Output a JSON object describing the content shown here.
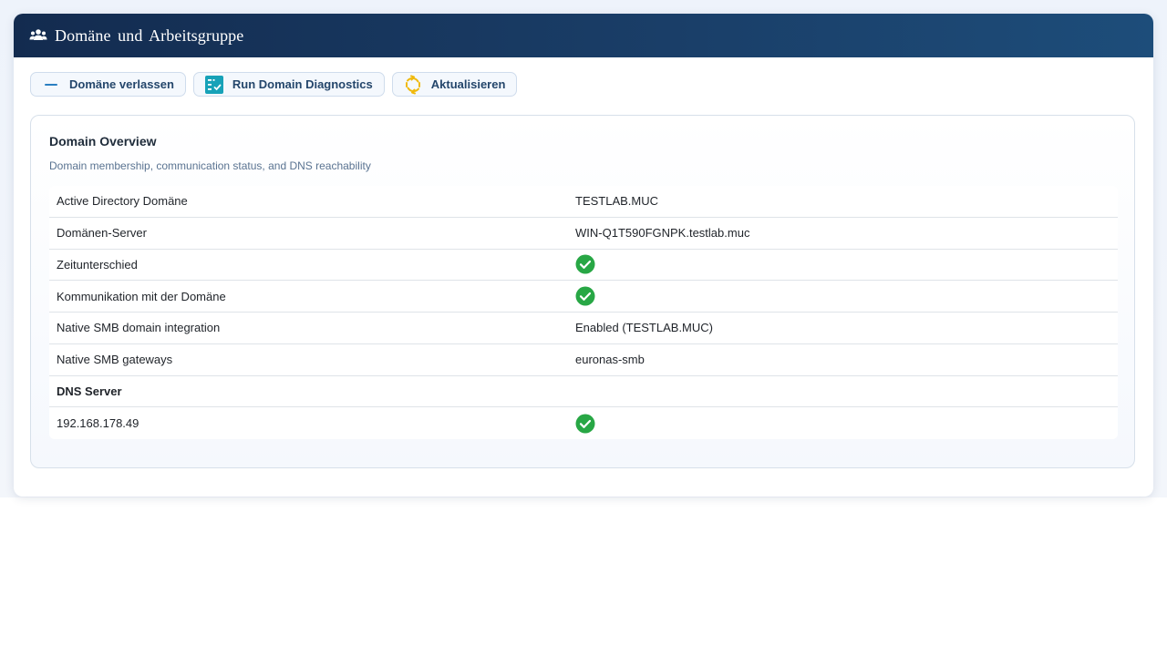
{
  "window": {
    "title": "Domäne und Arbeitsgruppe",
    "title_icon": "users-group-icon"
  },
  "toolbar": {
    "leave_label": "Domäne verlassen",
    "leave_icon": "minus-icon",
    "diagnostics_label": "Run Domain Diagnostics",
    "diagnostics_icon": "checklist-icon",
    "refresh_label": "Aktualisieren",
    "refresh_icon": "refresh-icon"
  },
  "panel": {
    "title": "Domain Overview",
    "subtitle": "Domain membership, communication status, and DNS reachability"
  },
  "rows": [
    {
      "key": "Active Directory Domäne",
      "value": "TESTLAB.MUC"
    },
    {
      "key": "Domänen-Server",
      "value": "WIN-Q1T590FGNPK.testlab.muc"
    },
    {
      "key": "Zeitunterschied",
      "status": "ok"
    },
    {
      "key": "Kommunikation mit der Domäne",
      "status": "ok"
    },
    {
      "key": "Native SMB domain integration",
      "value": "Enabled (TESTLAB.MUC)"
    },
    {
      "key": "Native SMB gateways",
      "value": "euronas-smb"
    },
    {
      "key": "DNS Server",
      "section": true
    },
    {
      "key": "192.168.178.49",
      "status": "ok"
    }
  ],
  "colors": {
    "title_bar": "#132b4f",
    "accent_blue": "#2a7fc1",
    "diagnostics_teal": "#17a2b8",
    "refresh_yellow": "#f0b90b",
    "ok_green": "#28a745"
  }
}
